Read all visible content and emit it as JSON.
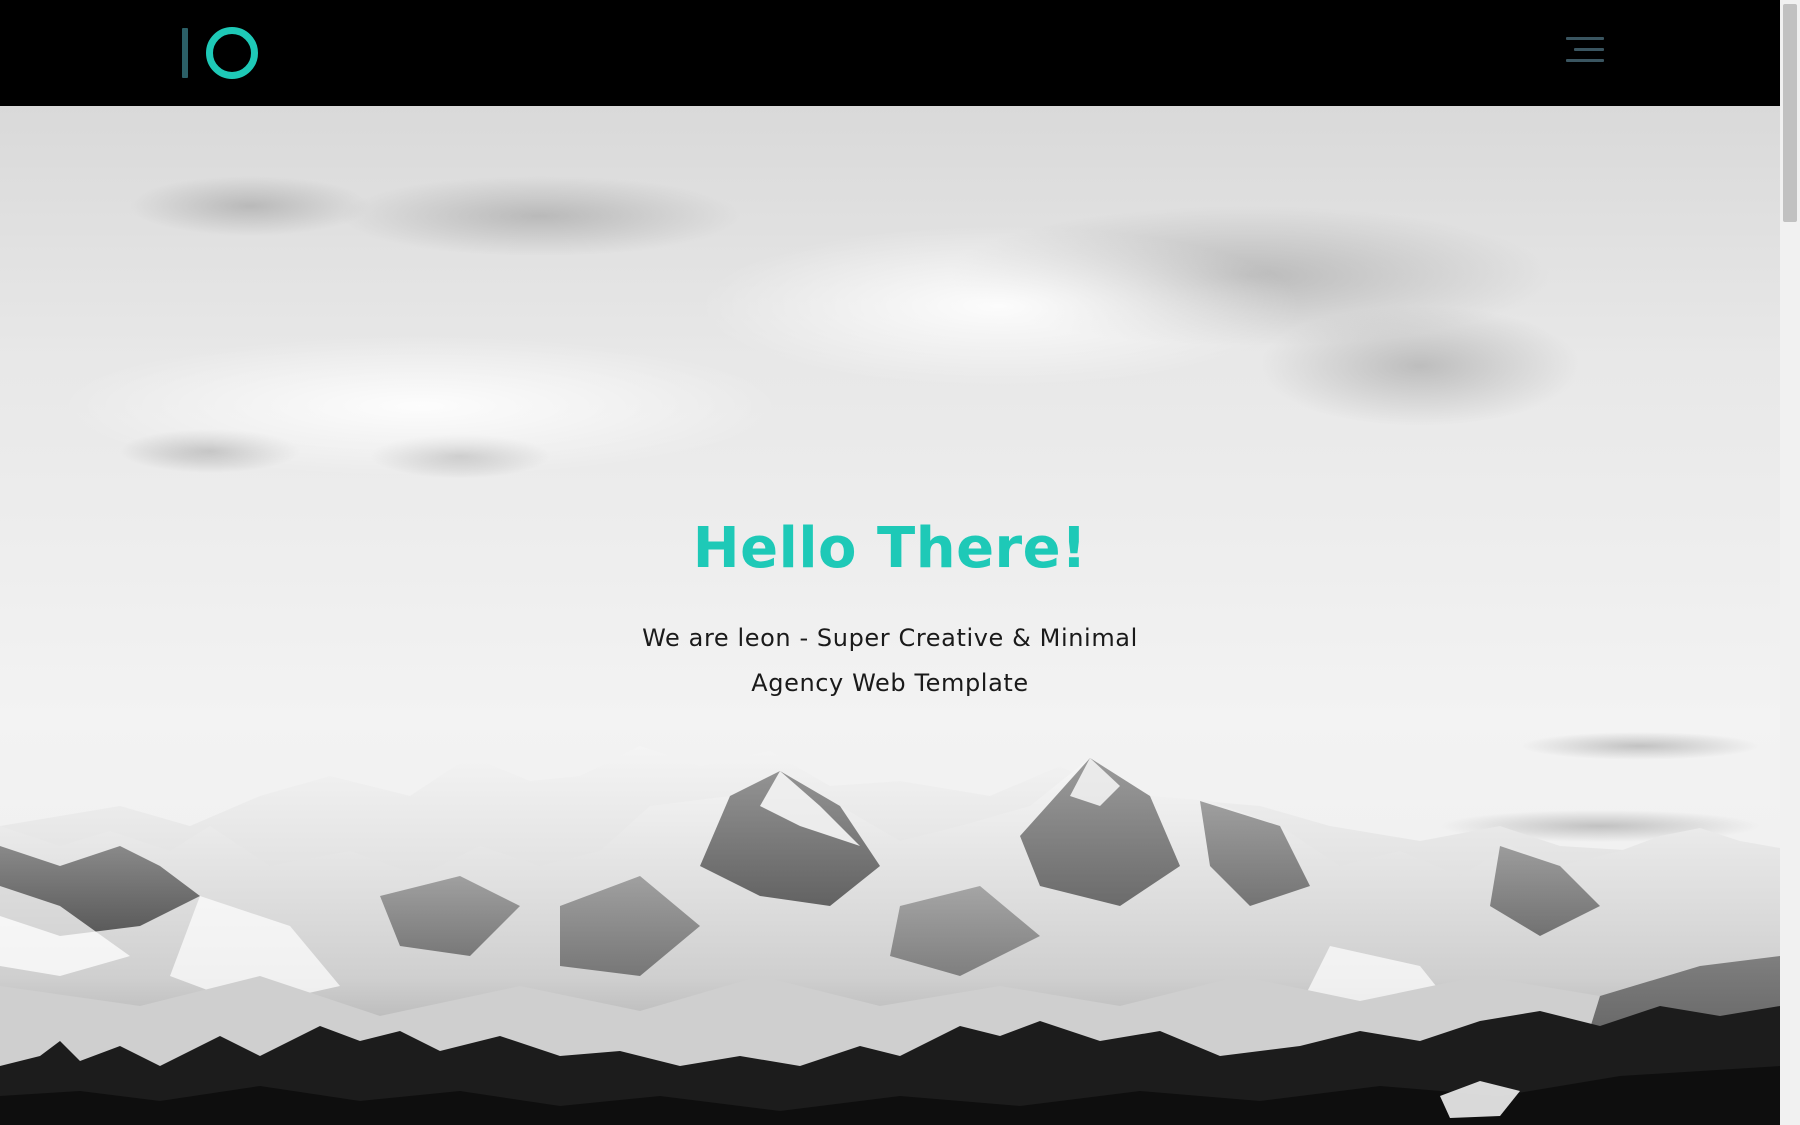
{
  "colors": {
    "accent": "#1ec9b7",
    "accent_dark": "#2b5f66",
    "header_bg": "#000000",
    "menu_icon": "#3a5560"
  },
  "header": {
    "logo_icon": "io-logo-icon",
    "menu_icon": "hamburger-menu-icon"
  },
  "hero": {
    "title": "Hello There!",
    "subtitle_line1": "We are leon - Super Creative & Minimal",
    "subtitle_line2": "Agency Web Template",
    "background": "snowy-mountains-monochrome-photo"
  }
}
